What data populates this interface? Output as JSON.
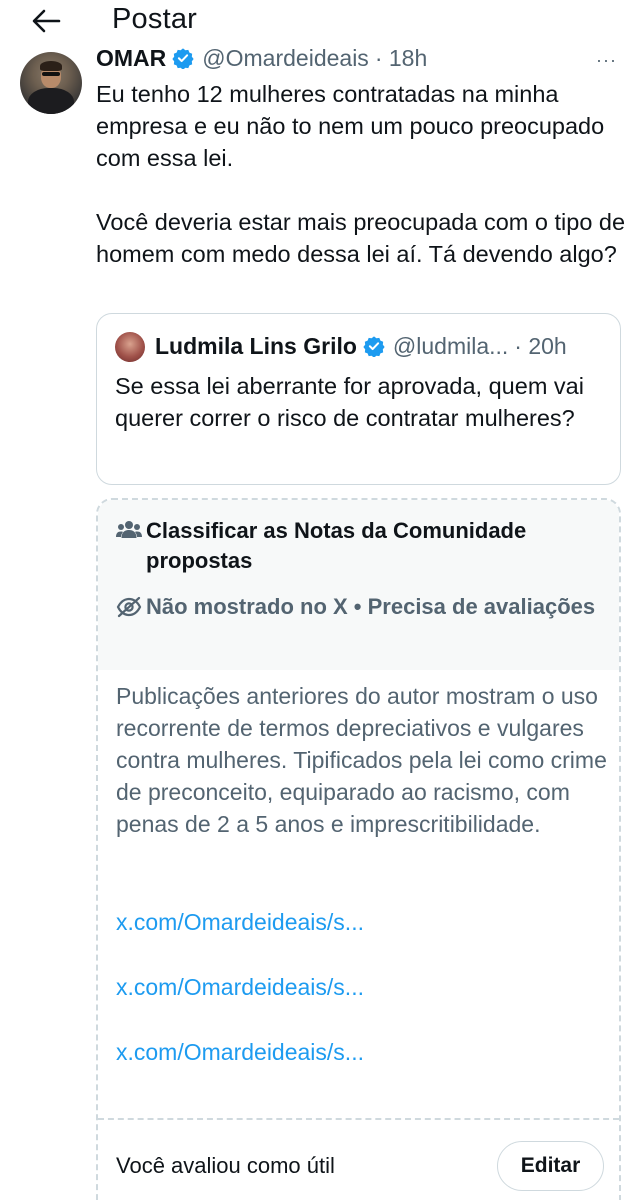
{
  "header": {
    "title": "Postar"
  },
  "tweet": {
    "author": "OMAR",
    "handle": "@Omardeideais",
    "time": "· 18h",
    "more": "···",
    "text": "Eu tenho 12 mulheres contratadas na minha empresa e eu não to nem um pouco preocupado com essa lei.\n\nVocê deveria estar mais preocupada com o tipo de homem com medo dessa lei aí. Tá devendo algo?"
  },
  "quote": {
    "author": "Ludmila Lins Grilo",
    "handle": "@ludmila...",
    "time": "· 20h",
    "text": "Se essa lei aberrante for aprovada, quem vai querer correr o risco de contratar mulheres?"
  },
  "community_note": {
    "title": "Classificar as Notas da Comunidade propostas",
    "status": "Não mostrado no X • Precisa de avaliações",
    "body": "Publicações anteriores do autor mostram o uso recorrente de termos depreciativos e vulgares contra mulheres. Tipificados pela lei como crime de preconceito, equiparado ao racismo, com penas de 2 a 5 anos e imprescritibilidade.",
    "links": [
      "x.com/Omardeideais/s...",
      "x.com/Omardeideais/s...",
      "x.com/Omardeideais/s..."
    ],
    "rated_text": "Você avaliou como útil",
    "edit_label": "Editar"
  },
  "colors": {
    "accent": "#1d9bf0",
    "verified": "#1d9bf0",
    "secondary_text": "#536471",
    "border": "#cfd9de"
  }
}
